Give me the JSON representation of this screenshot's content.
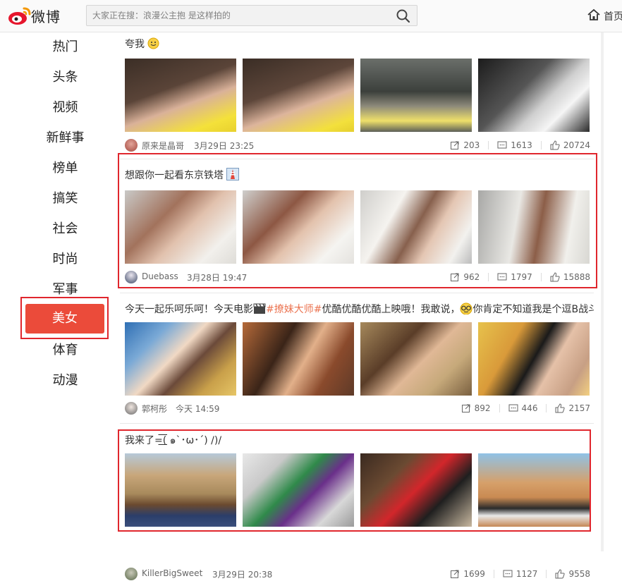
{
  "header": {
    "logo_text": "微博",
    "search_placeholder": "大家正在搜：浪漫公主抱 是这样拍的",
    "home_label": "首页"
  },
  "sidebar": {
    "items": [
      {
        "label": "热门"
      },
      {
        "label": "头条"
      },
      {
        "label": "视频"
      },
      {
        "label": "新鲜事"
      },
      {
        "label": "榜单"
      },
      {
        "label": "搞笑"
      },
      {
        "label": "社会"
      },
      {
        "label": "时尚"
      },
      {
        "label": "军事"
      },
      {
        "label": "美女"
      },
      {
        "label": "体育"
      },
      {
        "label": "动漫"
      }
    ],
    "active_index": 9
  },
  "posts": [
    {
      "text": "夸我",
      "author": "原来是晶哥",
      "time": "3月29日 23:25",
      "reposts": "203",
      "comments": "1613",
      "likes": "20724"
    },
    {
      "text": "想跟你一起看东京铁塔",
      "author": "Duebass",
      "time": "3月28日 19:47",
      "reposts": "962",
      "comments": "1797",
      "likes": "15888"
    },
    {
      "text_before": "今天一起乐呵乐呵！今天电影",
      "tag": "#撩妹大师#",
      "text_after": "优酷优酷优酷上映哦！我敢说，",
      "text_end": "你肯定不知道我是个逗B战斗",
      "author": "郭柯彤",
      "time": "今天 14:59",
      "reposts": "892",
      "comments": "446",
      "likes": "2157"
    },
    {
      "text": "我来了=͟͟͞͞( ๑`･ω･´) /)/",
      "author": "KillerBigSweet",
      "time": "3月29日 20:38",
      "reposts": "1699",
      "comments": "1127",
      "likes": "9558"
    }
  ],
  "colors": {
    "accent": "#eb4b3a",
    "highlight_border": "#e0262d",
    "tag": "#eb7350"
  }
}
